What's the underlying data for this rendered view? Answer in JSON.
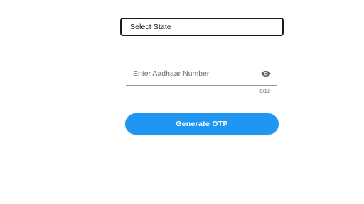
{
  "state_select": {
    "value": "Select State"
  },
  "aadhaar": {
    "placeholder": "Enter Aadhaar Number",
    "value": "",
    "counter": "0/12",
    "toggle_icon": "eye-icon"
  },
  "actions": {
    "generate_otp_label": "Generate OTP"
  },
  "colors": {
    "primary": "#1f97f2",
    "border": "#1a1a1a",
    "underline": "#9a9a9a",
    "muted_text": "#6b6b6b",
    "icon": "#666666"
  }
}
